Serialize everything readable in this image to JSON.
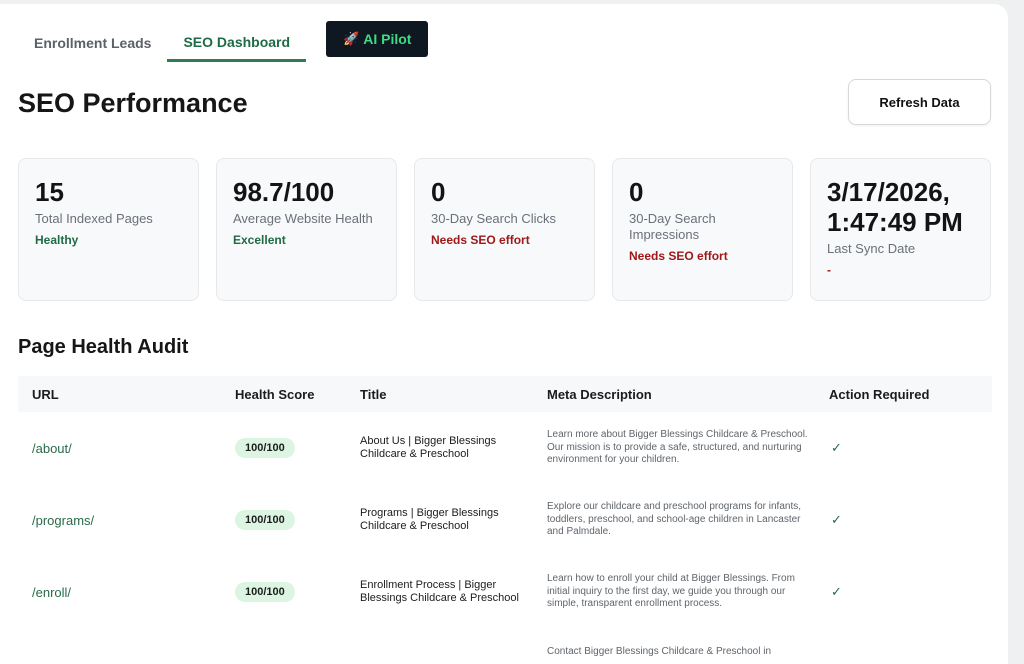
{
  "tabs": {
    "enrollment": "Enrollment Leads",
    "seo": "SEO Dashboard",
    "ai_icon": "🚀",
    "ai": "AI Pilot"
  },
  "header": {
    "title": "SEO Performance",
    "refresh_label": "Refresh Data"
  },
  "cards": [
    {
      "value": "15",
      "label": "Total Indexed Pages",
      "status": "Healthy"
    },
    {
      "value": "98.7/100",
      "label": "Average Website Health",
      "status": "Excellent"
    },
    {
      "value": "0",
      "label": "30-Day Search Clicks",
      "status": "Needs SEO effort"
    },
    {
      "value": "0",
      "label": "30-Day Search Impressions",
      "status": "Needs SEO effort"
    },
    {
      "value": "3/17/2026, 1:47:49 PM",
      "label": "Last Sync Date",
      "status": "-"
    }
  ],
  "audit": {
    "title": "Page Health Audit",
    "columns": {
      "url": "URL",
      "score": "Health Score",
      "title": "Title",
      "meta": "Meta Description",
      "action": "Action Required"
    },
    "rows": [
      {
        "url": "/about/",
        "score": "100/100",
        "title": "About Us | Bigger Blessings Childcare & Preschool",
        "meta": "Learn more about Bigger Blessings Childcare & Preschool. Our mission is to provide a safe, structured, and nurturing environment for your children.",
        "action": "✓"
      },
      {
        "url": "/programs/",
        "score": "100/100",
        "title": "Programs | Bigger Blessings Childcare & Preschool",
        "meta": "Explore our childcare and preschool programs for infants, toddlers, preschool, and school-age children in Lancaster and Palmdale.",
        "action": "✓"
      },
      {
        "url": "/enroll/",
        "score": "100/100",
        "title": "Enrollment Process | Bigger Blessings Childcare & Preschool",
        "meta": "Learn how to enroll your child at Bigger Blessings. From initial inquiry to the first day, we guide you through our simple, transparent enrollment process.",
        "action": "✓"
      }
    ],
    "partial_meta": "Contact Bigger Blessings Childcare & Preschool in"
  }
}
